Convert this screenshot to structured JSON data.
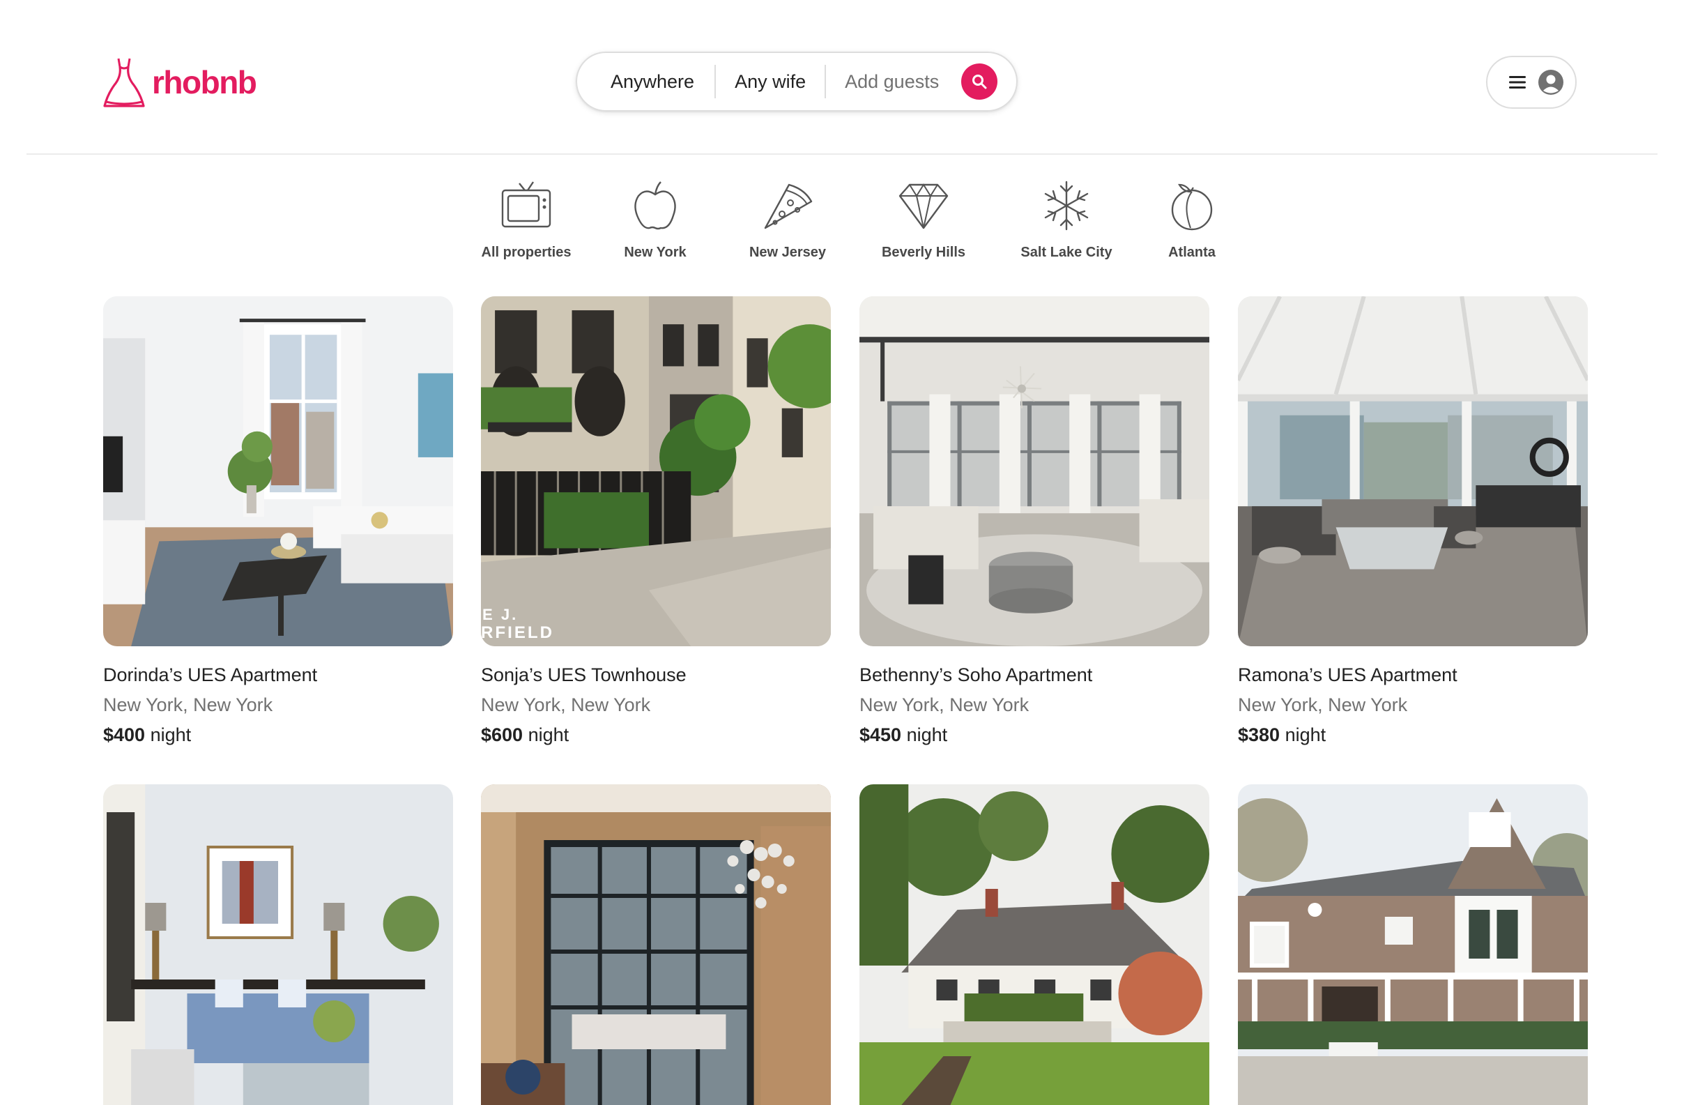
{
  "brand": {
    "name": "rhobnb",
    "color": "#e31c5f"
  },
  "search": {
    "where": "Anywhere",
    "who": "Any wife",
    "guests_placeholder": "Add guests",
    "icon": "search-icon"
  },
  "user_menu": {
    "menu_icon": "hamburger-icon",
    "avatar_icon": "user-avatar-icon"
  },
  "categories": [
    {
      "label": "All properties",
      "icon": "tv-icon"
    },
    {
      "label": "New York",
      "icon": "apple-icon"
    },
    {
      "label": "New Jersey",
      "icon": "pizza-icon"
    },
    {
      "label": "Beverly Hills",
      "icon": "diamond-icon"
    },
    {
      "label": "Salt Lake City",
      "icon": "snowflake-icon"
    },
    {
      "label": "Atlanta",
      "icon": "peach-icon"
    }
  ],
  "listings": [
    {
      "title": "Dorinda’s UES Apartment",
      "location": "New York, New York",
      "price": "$400",
      "unit": "night"
    },
    {
      "title": "Sonja’s UES Townhouse",
      "location": "New York, New York",
      "price": "$600",
      "unit": "night",
      "photo_text": "E J.\nRFIELD"
    },
    {
      "title": "Bethenny’s Soho Apartment",
      "location": "New York, New York",
      "price": "$450",
      "unit": "night"
    },
    {
      "title": "Ramona’s UES Apartment",
      "location": "New York, New York",
      "price": "$380",
      "unit": "night"
    },
    {
      "title": "",
      "location": "",
      "price": "",
      "unit": ""
    },
    {
      "title": "",
      "location": "",
      "price": "",
      "unit": ""
    },
    {
      "title": "",
      "location": "",
      "price": "",
      "unit": ""
    },
    {
      "title": "",
      "location": "",
      "price": "",
      "unit": ""
    }
  ]
}
